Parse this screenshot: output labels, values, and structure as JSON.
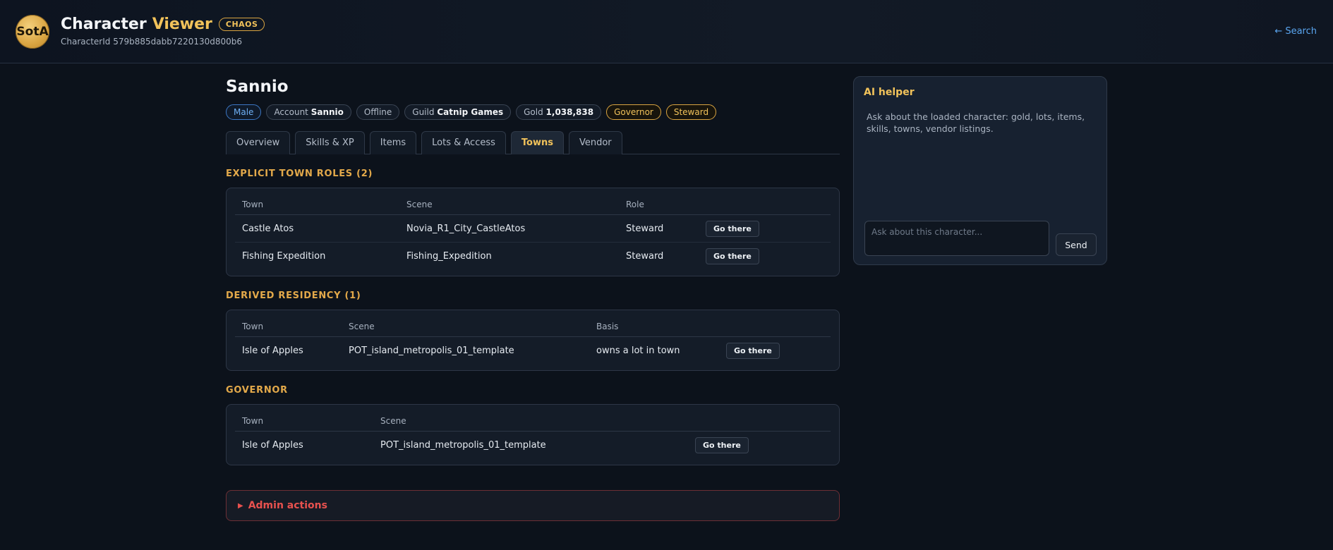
{
  "header": {
    "logo_text": "SotA",
    "title": "Character",
    "title_accent": "Viewer",
    "badge": "CHAOS",
    "character_id": "CharacterId 579b885dabb7220130d800b6",
    "search_link": "← Search"
  },
  "character": {
    "name": "Sannio",
    "chips": {
      "gender": "Male",
      "account_label": "Account",
      "account_value": "Sannio",
      "status": "Offline",
      "guild_label": "Guild",
      "guild_value": "Catnip Games",
      "gold_label": "Gold",
      "gold_value": "1,038,838",
      "role1": "Governor",
      "role2": "Steward"
    }
  },
  "tabs": [
    "Overview",
    "Skills & XP",
    "Items",
    "Lots & Access",
    "Towns",
    "Vendor"
  ],
  "active_tab": "Towns",
  "explicit_roles": {
    "title": "EXPLICIT TOWN ROLES (2)",
    "columns": [
      "Town",
      "Scene",
      "Role"
    ],
    "rows": [
      {
        "town": "Castle Atos",
        "scene": "Novia_R1_City_CastleAtos",
        "role": "Steward",
        "action": "Go there"
      },
      {
        "town": "Fishing Expedition",
        "scene": "Fishing_Expedition",
        "role": "Steward",
        "action": "Go there"
      }
    ]
  },
  "derived_residency": {
    "title": "DERIVED RESIDENCY (1)",
    "columns": [
      "Town",
      "Scene",
      "Basis"
    ],
    "rows": [
      {
        "town": "Isle of Apples",
        "scene": "POT_island_metropolis_01_template",
        "basis": "owns a lot in town",
        "action": "Go there"
      }
    ]
  },
  "governor": {
    "title": "GOVERNOR",
    "columns": [
      "Town",
      "Scene"
    ],
    "rows": [
      {
        "town": "Isle of Apples",
        "scene": "POT_island_metropolis_01_template",
        "action": "Go there"
      }
    ]
  },
  "admin": {
    "label": "Admin actions"
  },
  "ai_helper": {
    "title": "AI helper",
    "description": "Ask about the loaded character: gold, lots, items, skills, towns, vendor listings.",
    "placeholder": "Ask about this character...",
    "send_label": "Send"
  }
}
